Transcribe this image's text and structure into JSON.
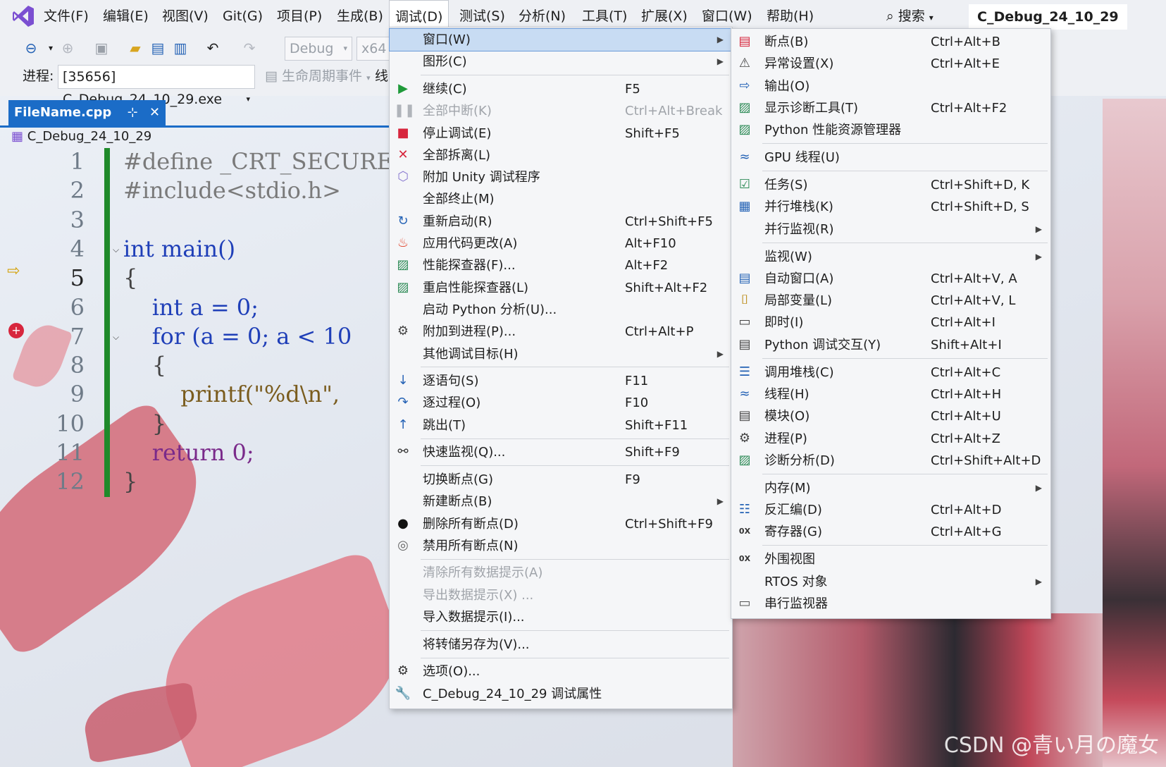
{
  "menubar": {
    "items": [
      "文件(F)",
      "编辑(E)",
      "视图(V)",
      "Git(G)",
      "项目(P)",
      "生成(B)",
      "调试(D)",
      "测试(S)",
      "分析(N)",
      "工具(T)",
      "扩展(X)",
      "窗口(W)",
      "帮助(H)"
    ],
    "search_label": "搜索",
    "solution_name": "C_Debug_24_10_29"
  },
  "toolbar": {
    "config": "Debug",
    "platform": "x64",
    "process_label": "进程:",
    "process_value": "[35656] C_Debug_24_10_29.exe",
    "lifecycle_label": "生命周期事件",
    "thread_label": "线"
  },
  "editor": {
    "tab_name": "FileName.cpp",
    "nav_scope": "C_Debug_24_10_29",
    "line_numbers": [
      "1",
      "2",
      "3",
      "4",
      "5",
      "6",
      "7",
      "8",
      "9",
      "10",
      "11",
      "12"
    ],
    "lines": [
      "#define _CRT_SECURE_NO",
      "#include<stdio.h>",
      "",
      "int main()",
      "{",
      "    int a = 0;",
      "    for (a = 0; a < 10",
      "    {",
      "        printf(\"%d\\n\",",
      "    }",
      "    return 0;",
      "}"
    ]
  },
  "debug_menu": [
    {
      "label": "窗口(W)",
      "shortcut": "",
      "icon": "",
      "submenu": true,
      "highlight": true
    },
    {
      "label": "图形(C)",
      "shortcut": "",
      "icon": "",
      "submenu": true
    },
    {
      "sep": true
    },
    {
      "label": "继续(C)",
      "shortcut": "F5",
      "icon": "play-icon"
    },
    {
      "label": "全部中断(K)",
      "shortcut": "Ctrl+Alt+Break",
      "icon": "pause-icon",
      "disabled": true
    },
    {
      "label": "停止调试(E)",
      "shortcut": "Shift+F5",
      "icon": "stop-icon"
    },
    {
      "label": "全部拆离(L)",
      "shortcut": "",
      "icon": "detach-icon"
    },
    {
      "label": "附加 Unity 调试程序",
      "shortcut": "",
      "icon": "unity-icon"
    },
    {
      "label": "全部终止(M)",
      "shortcut": "",
      "icon": ""
    },
    {
      "label": "重新启动(R)",
      "shortcut": "Ctrl+Shift+F5",
      "icon": "restart-icon"
    },
    {
      "label": "应用代码更改(A)",
      "shortcut": "Alt+F10",
      "icon": "hot-reload-icon"
    },
    {
      "label": "性能探查器(F)...",
      "shortcut": "Alt+F2",
      "icon": "profiler-icon"
    },
    {
      "label": "重启性能探查器(L)",
      "shortcut": "Shift+Alt+F2",
      "icon": "profiler-restart-icon"
    },
    {
      "label": "启动 Python 分析(U)...",
      "shortcut": "",
      "icon": ""
    },
    {
      "label": "附加到进程(P)...",
      "shortcut": "Ctrl+Alt+P",
      "icon": "attach-process-icon"
    },
    {
      "label": "其他调试目标(H)",
      "shortcut": "",
      "icon": "",
      "submenu": true
    },
    {
      "sep": true
    },
    {
      "label": "逐语句(S)",
      "shortcut": "F11",
      "icon": "step-into-icon"
    },
    {
      "label": "逐过程(O)",
      "shortcut": "F10",
      "icon": "step-over-icon"
    },
    {
      "label": "跳出(T)",
      "shortcut": "Shift+F11",
      "icon": "step-out-icon"
    },
    {
      "sep": true
    },
    {
      "label": "快速监视(Q)...",
      "shortcut": "Shift+F9",
      "icon": "quickwatch-icon"
    },
    {
      "sep": true
    },
    {
      "label": "切换断点(G)",
      "shortcut": "F9",
      "icon": ""
    },
    {
      "label": "新建断点(B)",
      "shortcut": "",
      "icon": "",
      "submenu": true
    },
    {
      "label": "删除所有断点(D)",
      "shortcut": "Ctrl+Shift+F9",
      "icon": "delete-breakpoints-icon"
    },
    {
      "label": "禁用所有断点(N)",
      "shortcut": "",
      "icon": "disable-breakpoints-icon"
    },
    {
      "sep": true
    },
    {
      "label": "清除所有数据提示(A)",
      "shortcut": "",
      "icon": "",
      "disabled": true
    },
    {
      "label": "导出数据提示(X) ...",
      "shortcut": "",
      "icon": "",
      "disabled": true
    },
    {
      "label": "导入数据提示(I)...",
      "shortcut": "",
      "icon": ""
    },
    {
      "sep": true
    },
    {
      "label": "将转储另存为(V)...",
      "shortcut": "",
      "icon": ""
    },
    {
      "sep": true
    },
    {
      "label": "选项(O)...",
      "shortcut": "",
      "icon": "gear-icon"
    },
    {
      "label": "C_Debug_24_10_29 调试属性",
      "shortcut": "",
      "icon": "wrench-icon"
    }
  ],
  "window_submenu": [
    {
      "label": "断点(B)",
      "shortcut": "Ctrl+Alt+B",
      "icon": "breakpoints-window-icon"
    },
    {
      "label": "异常设置(X)",
      "shortcut": "Ctrl+Alt+E",
      "icon": "exception-settings-icon"
    },
    {
      "label": "输出(O)",
      "shortcut": "",
      "icon": "output-icon"
    },
    {
      "label": "显示诊断工具(T)",
      "shortcut": "Ctrl+Alt+F2",
      "icon": "diagnostic-tools-icon"
    },
    {
      "label": "Python 性能资源管理器",
      "shortcut": "",
      "icon": "python-perf-icon"
    },
    {
      "sep": true
    },
    {
      "label": "GPU 线程(U)",
      "shortcut": "",
      "icon": "gpu-threads-icon"
    },
    {
      "sep": true
    },
    {
      "label": "任务(S)",
      "shortcut": "Ctrl+Shift+D, K",
      "icon": "tasks-icon"
    },
    {
      "label": "并行堆栈(K)",
      "shortcut": "Ctrl+Shift+D, S",
      "icon": "parallel-stacks-icon"
    },
    {
      "label": "并行监视(R)",
      "shortcut": "",
      "icon": "",
      "submenu": true
    },
    {
      "sep": true
    },
    {
      "label": "监视(W)",
      "shortcut": "",
      "icon": "",
      "submenu": true
    },
    {
      "label": "自动窗口(A)",
      "shortcut": "Ctrl+Alt+V, A",
      "icon": "autos-icon"
    },
    {
      "label": "局部变量(L)",
      "shortcut": "Ctrl+Alt+V, L",
      "icon": "locals-icon"
    },
    {
      "label": "即时(I)",
      "shortcut": "Ctrl+Alt+I",
      "icon": "immediate-icon"
    },
    {
      "label": "Python 调试交互(Y)",
      "shortcut": "Shift+Alt+I",
      "icon": "python-interactive-icon"
    },
    {
      "sep": true
    },
    {
      "label": "调用堆栈(C)",
      "shortcut": "Ctrl+Alt+C",
      "icon": "call-stack-icon"
    },
    {
      "label": "线程(H)",
      "shortcut": "Ctrl+Alt+H",
      "icon": "threads-icon"
    },
    {
      "label": "模块(O)",
      "shortcut": "Ctrl+Alt+U",
      "icon": "modules-icon"
    },
    {
      "label": "进程(P)",
      "shortcut": "Ctrl+Alt+Z",
      "icon": "processes-icon"
    },
    {
      "label": "诊断分析(D)",
      "shortcut": "Ctrl+Shift+Alt+D",
      "icon": "diagnostic-analysis-icon"
    },
    {
      "sep": true
    },
    {
      "label": "内存(M)",
      "shortcut": "",
      "icon": "",
      "submenu": true
    },
    {
      "label": "反汇编(D)",
      "shortcut": "Ctrl+Alt+D",
      "icon": "disassembly-icon"
    },
    {
      "label": "寄存器(G)",
      "shortcut": "Ctrl+Alt+G",
      "icon": "registers-icon"
    },
    {
      "sep": true
    },
    {
      "label": "外围视图",
      "shortcut": "",
      "icon": "peripheral-view-icon"
    },
    {
      "label": "RTOS 对象",
      "shortcut": "",
      "icon": "",
      "submenu": true
    },
    {
      "label": "串行监视器",
      "shortcut": "",
      "icon": "serial-monitor-icon"
    }
  ],
  "watermark": "CSDN @青い月の魔女",
  "colors": {
    "accent": "#1b6cc7",
    "gutter_green": "#1f8a2a",
    "highlight": "#c8dcf3"
  }
}
